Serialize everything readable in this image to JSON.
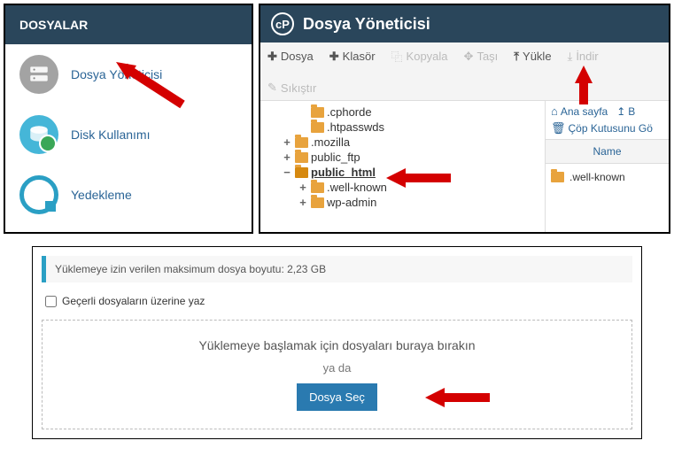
{
  "left": {
    "header": "DOSYALAR",
    "items": [
      {
        "label": "Dosya Yöneticisi"
      },
      {
        "label": "Disk Kullanımı"
      },
      {
        "label": "Yedekleme"
      }
    ]
  },
  "fm": {
    "title": "Dosya Yöneticisi",
    "toolbar": {
      "file": "Dosya",
      "folder": "Klasör",
      "copy": "Kopyala",
      "move": "Taşı",
      "upload": "Yükle",
      "download": "İndir",
      "compress": "Sıkıştır"
    },
    "tree": [
      {
        "indent": 2,
        "exp": "",
        "name": ".cphorde"
      },
      {
        "indent": 2,
        "exp": "",
        "name": ".htpasswds"
      },
      {
        "indent": 1,
        "exp": "+",
        "name": ".mozilla"
      },
      {
        "indent": 1,
        "exp": "+",
        "name": "public_ftp"
      },
      {
        "indent": 1,
        "exp": "−",
        "name": "public_html",
        "selected": true
      },
      {
        "indent": 2,
        "exp": "+",
        "name": ".well-known"
      },
      {
        "indent": 2,
        "exp": "+",
        "name": "wp-admin"
      }
    ],
    "side": {
      "home": "Ana sayfa",
      "b_link": "B",
      "trash": "Çöp Kutusunu Gö",
      "name_header": "Name",
      "row1": ".well-known"
    }
  },
  "upload": {
    "max_size_label": "Yüklemeye izin verilen maksimum dosya boyutu: 2,23 GB",
    "overwrite_label": "Geçerli dosyaların üzerine yaz",
    "drop_label": "Yüklemeye başlamak için dosyaları buraya bırakın",
    "or_label": "ya da",
    "select_btn": "Dosya Seç"
  }
}
